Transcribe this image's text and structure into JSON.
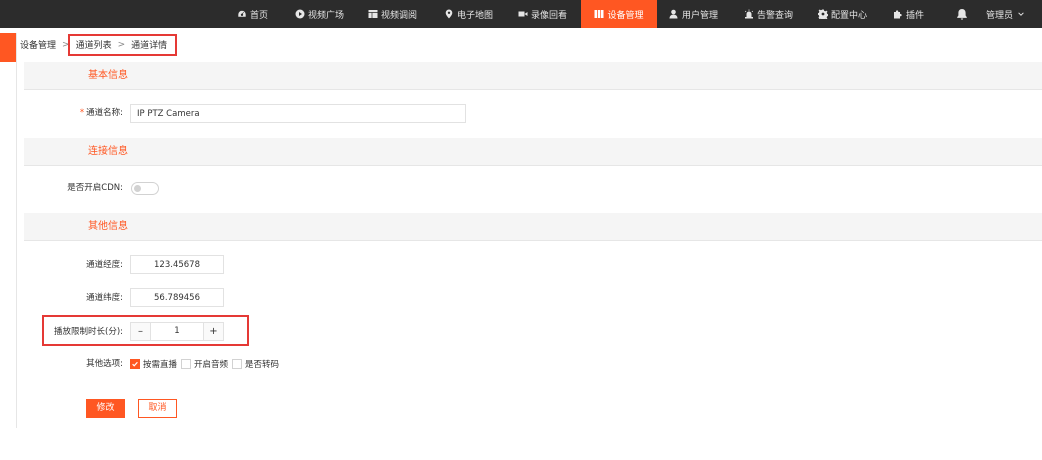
{
  "nav": {
    "items": [
      {
        "label": "首页",
        "icon": "dashboard-icon"
      },
      {
        "label": "视频广场",
        "icon": "play-circle-icon"
      },
      {
        "label": "视频调阅",
        "icon": "video-grid-icon"
      },
      {
        "label": "电子地图",
        "icon": "map-pin-icon"
      },
      {
        "label": "录像回看",
        "icon": "video-camera-icon"
      },
      {
        "label": "设备管理",
        "icon": "devices-icon"
      },
      {
        "label": "用户管理",
        "icon": "user-icon"
      },
      {
        "label": "告警查询",
        "icon": "alarm-icon"
      },
      {
        "label": "配置中心",
        "icon": "gear-icon"
      },
      {
        "label": "插件",
        "icon": "puzzle-icon"
      }
    ],
    "active_index": 5,
    "user_label": "管理员",
    "accent_color": "#ff5722"
  },
  "breadcrumb": {
    "items": [
      "设备管理",
      "通道列表",
      "通道详情"
    ],
    "separator": ">"
  },
  "sections": {
    "basic": "基本信息",
    "connection": "连接信息",
    "other": "其他信息"
  },
  "form": {
    "channel_name": {
      "label": "通道名称:",
      "required_mark": "*",
      "value": "IP PTZ Camera"
    },
    "cdn": {
      "label": "是否开启CDN:",
      "enabled": false
    },
    "longitude": {
      "label": "通道经度:",
      "value": "123.45678"
    },
    "latitude": {
      "label": "通道纬度:",
      "value": "56.789456"
    },
    "play_limit": {
      "label": "播放限制时长(分):",
      "value": "1",
      "minus": "–",
      "plus": "+"
    },
    "options": {
      "label": "其他选项:",
      "items": [
        {
          "label": "按需直播",
          "checked": true
        },
        {
          "label": "开启音频",
          "checked": false
        },
        {
          "label": "是否转码",
          "checked": false
        }
      ]
    }
  },
  "buttons": {
    "submit": "修改",
    "cancel": "取消"
  }
}
